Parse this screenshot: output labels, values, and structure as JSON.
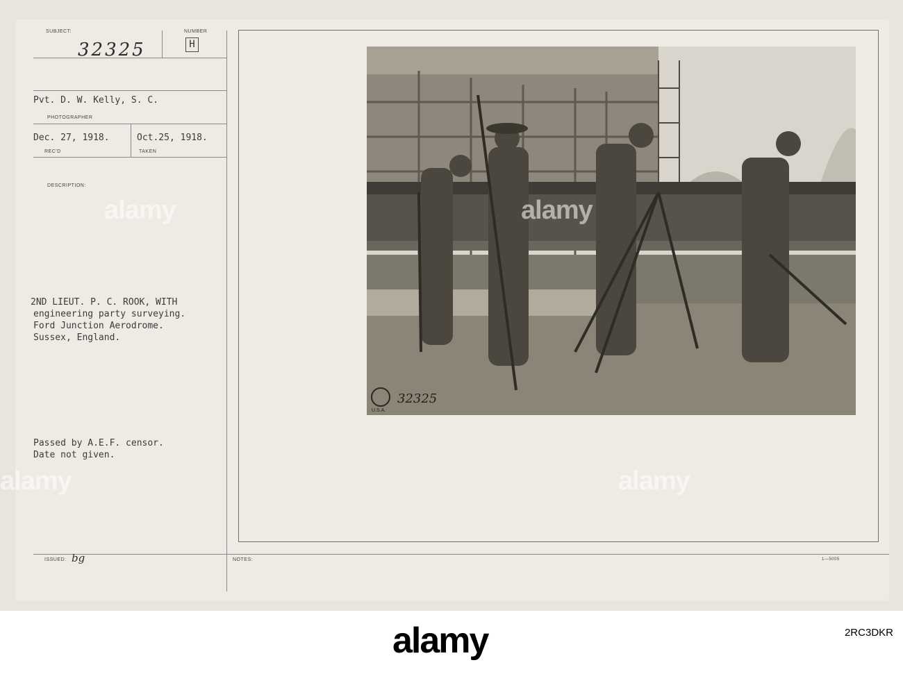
{
  "card": {
    "subject_label": "SUBJECT:",
    "number_label": "NUMBER",
    "subject_number": "32325",
    "number_mark": "H",
    "photographer_name": "Pvt. D. W. Kelly, S. C.",
    "photographer_label": "PHOTOGRAPHER",
    "received_date": "Dec. 27, 1918.",
    "received_label": "REC'D",
    "taken_date": "Oct.25, 1918.",
    "taken_label": "TAKEN",
    "description_label": "DESCRIPTION:",
    "description_lines": [
      "2ND LIEUT. P. C. ROOK, WITH",
      "engineering party surveying.",
      "Ford Junction Aerodrome.",
      "Sussex, England."
    ],
    "censor_lines": [
      "Passed by A.E.F. censor.",
      "Date not given."
    ],
    "issued_label": "ISSUED:",
    "issued_value": "bg",
    "notes_label": "NOTES:",
    "form_number": "1—5005",
    "photo_stamp_number": "32325",
    "photo_stamp_text": "U.S.A."
  },
  "watermark": {
    "text": "alamy"
  },
  "footer": {
    "logo": "alamy",
    "image_id": "2RC3DKR"
  }
}
